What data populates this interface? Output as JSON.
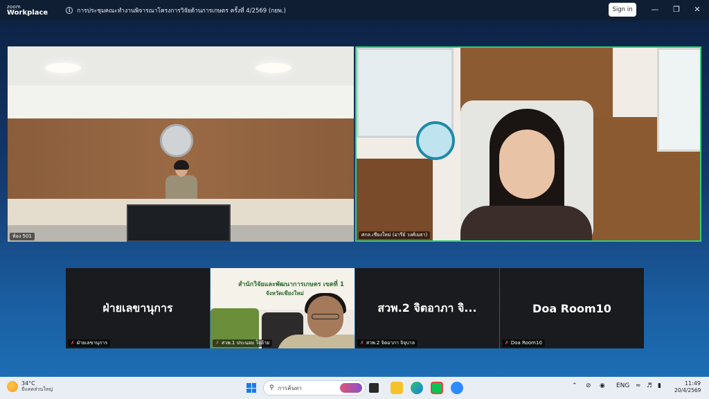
{
  "app": {
    "logo_line1": "zoom",
    "logo_line2": "Workplace",
    "meeting_title": "การประชุมคณะทำงานพิจารณาโครงการวิจัยด้านการเกษตร ครั้งที่ 4/2569 (กยพ.)",
    "sign_in_label": "Sign in",
    "window_controls": [
      "minimize-icon",
      "restore-icon",
      "close-icon"
    ]
  },
  "tiles": {
    "main_left": {
      "label": "ห้อง 501",
      "icon": "mic-off-icon"
    },
    "main_right": {
      "label": "ศกล.เชียงใหม่ (อารีย์ วงศ์เมธา)",
      "active_speaker_color": "#2ecf7a"
    },
    "bottom": [
      {
        "display_name": "ฝ่ายเลขานุการ",
        "label": "ฝ่ายเลขานุการ",
        "muted": true
      },
      {
        "display_name": "",
        "label": "สวพ.1 ประนอม ใจอ้าย",
        "muted": true,
        "poster_line1": "สำนักวิจัยและพัฒนาการเกษตร เขตที่ 1",
        "poster_line2": "จังหวัดเชียงใหม่"
      },
      {
        "display_name": "สวพ.2 จิตอาภา จิ...",
        "label": "สวพ.2 จิตอาภา จิจุบาล",
        "muted": true
      },
      {
        "display_name": "Doa Room10",
        "label": "Doa Room10",
        "muted": true
      }
    ]
  },
  "taskbar": {
    "weather_temp": "34°C",
    "weather_desc": "มีแดดส่วนใหญ่",
    "search_placeholder": "การค้นหา",
    "language": "ENG",
    "time": "11:49",
    "date": "20/4/2569",
    "icons": [
      "start-icon",
      "task-view-icon",
      "file-explorer-icon",
      "edge-icon",
      "line-icon",
      "zoom-icon"
    ],
    "accent": "#1a7fe0"
  }
}
